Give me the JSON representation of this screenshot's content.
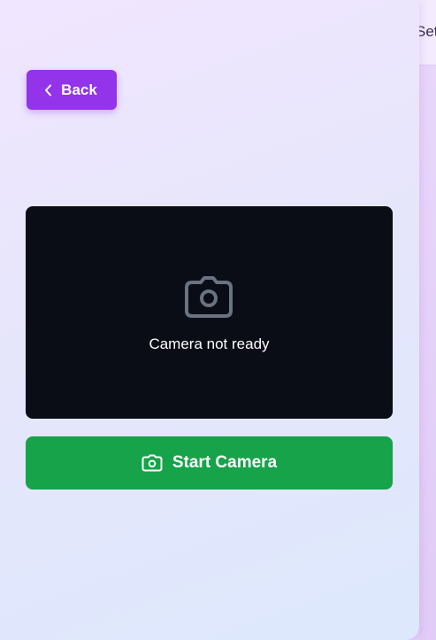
{
  "side_panel": {
    "tab_label": "Settings"
  },
  "toolbar": {
    "back_label": "Back"
  },
  "camera": {
    "status_text": "Camera not ready",
    "start_label": "Start Camera"
  },
  "icons": {
    "back": "chevron-left-icon",
    "camera_placeholder": "camera-icon",
    "start": "camera-icon"
  },
  "colors": {
    "back_button": "#9333ea",
    "start_button": "#16a34a",
    "camera_background": "#0a0d16",
    "placeholder_icon": "#6b7280"
  }
}
